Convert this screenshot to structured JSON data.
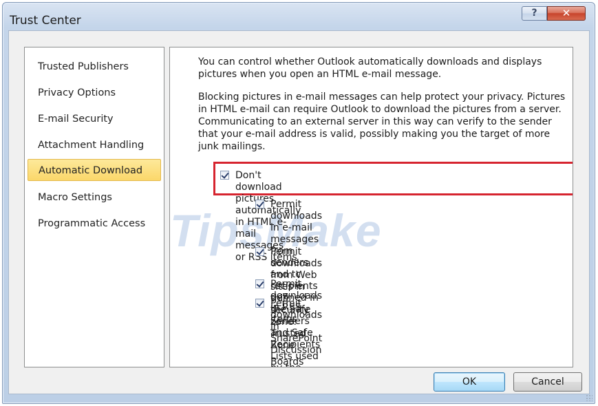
{
  "window": {
    "title": "Trust Center",
    "help_glyph": "?",
    "close_glyph": "✕"
  },
  "sidebar": {
    "items": [
      {
        "label": "Trusted Publishers",
        "selected": false
      },
      {
        "label": "Privacy Options",
        "selected": false
      },
      {
        "label": "E-mail Security",
        "selected": false
      },
      {
        "label": "Attachment Handling",
        "selected": false
      },
      {
        "label": "Automatic Download",
        "selected": true
      },
      {
        "label": "Macro Settings",
        "selected": false
      },
      {
        "label": "Programmatic Access",
        "selected": false
      }
    ]
  },
  "content": {
    "intro": "You can control whether Outlook automatically downloads and displays pictures when you open an HTML e-mail message.",
    "privacy": "Blocking pictures in e-mail messages can help protect your privacy. Pictures in HTML e-mail can require Outlook to download the pictures from a server. Communicating to an external server in this way can verify to the sender that your e-mail address is valid, possibly making you the target of more junk mailings.",
    "main_checkbox": {
      "label": "Don't download pictures automatically in HTML e-mail messages\nor RSS items",
      "checked": true,
      "highlight_color": "#d6242f"
    },
    "sub_checkboxes": [
      {
        "label": "Permit downloads in e-mail messages from senders and tc\nrecipients defined in the Safe Senders and Safe Recipients\nLists used by the Junk E-mail filter",
        "checked": true
      },
      {
        "label": "Permit downloads from Web sites in this security zone:\nTrusted Zone",
        "checked": true
      },
      {
        "label": "Permit downloads in RSS items",
        "checked": true
      },
      {
        "label": "Permit downloads in SharePoint Discussion Boards",
        "checked": true
      }
    ]
  },
  "watermark": {
    "text": "TipsMake"
  },
  "buttons": {
    "ok": "OK",
    "cancel": "Cancel"
  },
  "icons": {
    "help": "help-icon",
    "close": "close-icon",
    "checkbox": "checkmark-icon",
    "grip": "resize-grip-icon"
  }
}
